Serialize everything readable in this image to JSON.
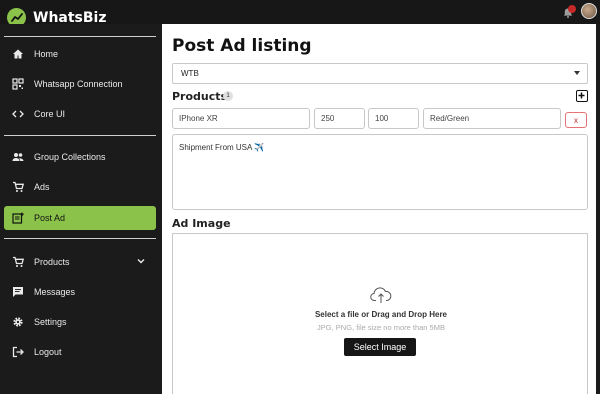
{
  "brand": {
    "name": "WhatsBiz",
    "icon": "trend-line-icon",
    "accent": "#8bc34a"
  },
  "sidebar": {
    "items": [
      {
        "label": "Home",
        "icon": "home-icon"
      },
      {
        "label": "Whatsapp Connection",
        "icon": "qr-code-icon"
      },
      {
        "label": "Core UI",
        "icon": "code-icon"
      },
      {
        "label": "Group Collections",
        "icon": "people-icon"
      },
      {
        "label": "Ads",
        "icon": "cart-icon"
      },
      {
        "label": "Post Ad",
        "icon": "post-add-icon",
        "active": true
      },
      {
        "label": "Products",
        "icon": "cart-icon",
        "expandable": true
      },
      {
        "label": "Messages",
        "icon": "message-icon"
      },
      {
        "label": "Settings",
        "icon": "gear-icon"
      },
      {
        "label": "Logout",
        "icon": "logout-icon"
      }
    ]
  },
  "main": {
    "title": "Post Ad listing",
    "ad_type": {
      "value": "WTB"
    },
    "products_label": "Products",
    "products_count": "1",
    "product_row": {
      "name": "IPhone XR",
      "quantity": "250",
      "price": "100",
      "variant": "Red/Green",
      "remove_label": "x"
    },
    "description": "Shipment From USA ✈️",
    "ad_image_label": "Ad Image",
    "dropzone": {
      "title": "Select a file or Drag and Drop Here",
      "subtitle": "JPG, PNG, file size no more than 5MB",
      "button": "Select Image"
    }
  }
}
